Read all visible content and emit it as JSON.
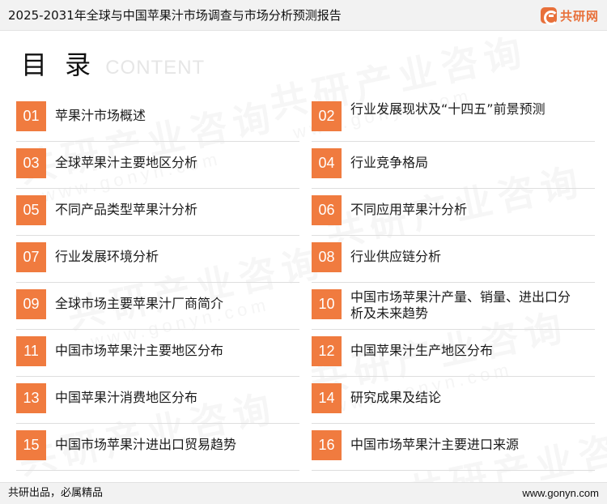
{
  "header": {
    "title": "2025-2031年全球与中国苹果汁市场调查与市场分析预测报告",
    "logo_text": "共研网"
  },
  "heading": {
    "main": "目 录",
    "sub": "CONTENT"
  },
  "watermark": {
    "text": "共研产业咨询",
    "url": "www.gonyn.com"
  },
  "toc": [
    {
      "num": "01",
      "label": "苹果汁市场概述"
    },
    {
      "num": "02",
      "label": "行业发展现状及“十四五”前景预测"
    },
    {
      "num": "03",
      "label": "全球苹果汁主要地区分析"
    },
    {
      "num": "04",
      "label": "行业竞争格局"
    },
    {
      "num": "05",
      "label": "不同产品类型苹果汁分析"
    },
    {
      "num": "06",
      "label": "不同应用苹果汁分析"
    },
    {
      "num": "07",
      "label": "行业发展环境分析"
    },
    {
      "num": "08",
      "label": "行业供应链分析"
    },
    {
      "num": "09",
      "label": "全球市场主要苹果汁厂商简介"
    },
    {
      "num": "10",
      "label": "中国市场苹果汁产量、销量、进出口分析及未来趋势"
    },
    {
      "num": "11",
      "label": "中国市场苹果汁主要地区分布"
    },
    {
      "num": "12",
      "label": "中国苹果汁生产地区分布"
    },
    {
      "num": "13",
      "label": "中国苹果汁消费地区分布"
    },
    {
      "num": "14",
      "label": "研究成果及结论"
    },
    {
      "num": "15",
      "label": "中国市场苹果汁进出口贸易趋势"
    },
    {
      "num": "16",
      "label": "中国市场苹果汁主要进口来源"
    }
  ],
  "footer": {
    "slogan": "共研出品，必属精品",
    "site": "www.gonyn.com"
  },
  "colors": {
    "accent": "#f07b3f",
    "brand": "#e8703a"
  }
}
